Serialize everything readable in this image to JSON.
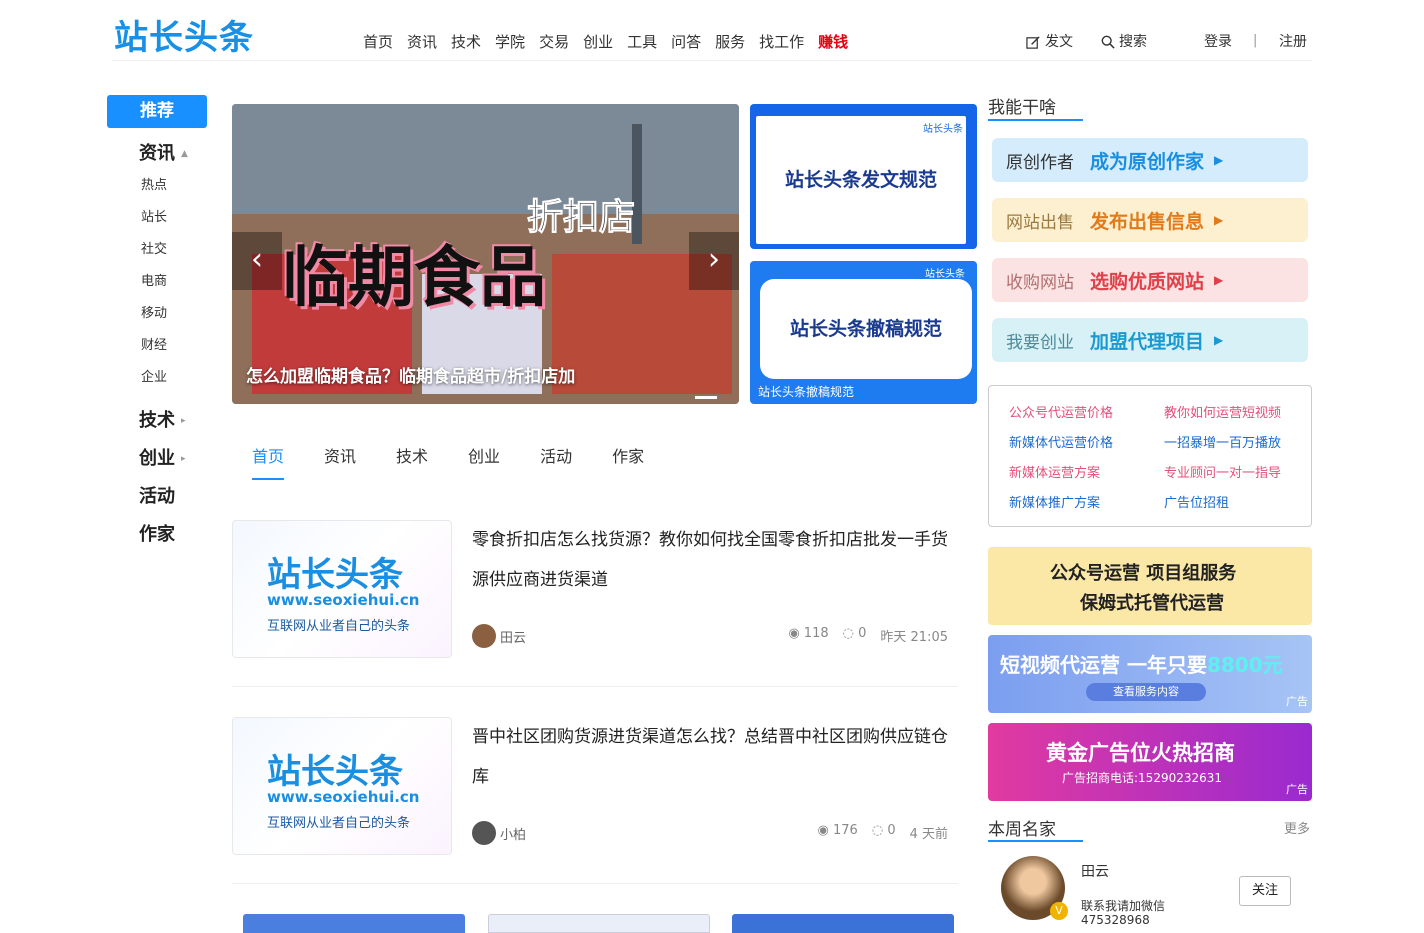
{
  "header": {
    "logo": "站长头条",
    "nav": [
      "首页",
      "资讯",
      "技术",
      "学院",
      "交易",
      "创业",
      "工具",
      "问答",
      "服务",
      "找工作",
      "赚钱"
    ],
    "post": "发文",
    "search": "搜索",
    "login": "登录",
    "sep": "|",
    "register": "注册"
  },
  "left_nav": {
    "recommend": "推荐",
    "cat_news": "资讯",
    "subs": [
      "热点",
      "站长",
      "社交",
      "电商",
      "移动",
      "财经",
      "企业"
    ],
    "cat_tech": "技术",
    "cat_startup": "创业",
    "cat_activity": "活动",
    "cat_author": "作家"
  },
  "slider": {
    "overlay_small": "折扣店",
    "overlay_big": "临期食品",
    "caption": "怎么加盟临期食品？临期食品超市/折扣店加",
    "prev": "‹",
    "next": "›"
  },
  "promos": [
    {
      "title": "站长头条发文规范",
      "tag": "站长头条"
    },
    {
      "title": "站长头条撤稿规范",
      "tag": "站长头条",
      "caption": "站长头条撤稿规范"
    }
  ],
  "tabs": [
    "首页",
    "资讯",
    "技术",
    "创业",
    "活动",
    "作家"
  ],
  "thumb": {
    "logo": "站长头条",
    "url": "www.seoxiehui.cn",
    "slogan": "互联网从业者自己的头条"
  },
  "articles": [
    {
      "title": "零食折扣店怎么找货源？教你如何找全国零食折扣店批发一手货源供应商进货渠道",
      "author": "田云",
      "views": "118",
      "comments": "0",
      "time": "昨天 21:05"
    },
    {
      "title": "晋中社区团购货源进货渠道怎么找？总结晋中社区团购供应链仓库",
      "author": "小柏",
      "views": "176",
      "comments": "0",
      "time": "4 天前"
    }
  ],
  "right": {
    "can_do_title": "我能干啥",
    "services": [
      {
        "a": "原创作者",
        "b": "成为原创作家"
      },
      {
        "a": "网站出售",
        "b": "发布出售信息"
      },
      {
        "a": "收购网站",
        "b": "选购优质网站"
      },
      {
        "a": "我要创业",
        "b": "加盟代理项目"
      }
    ],
    "links": [
      "公众号代运营价格",
      "教你如何运营短视频",
      "新媒体代运营价格",
      "一招暴增一百万播放",
      "新媒体运营方案",
      "专业顾问一对一指导",
      "新媒体推广方案",
      "广告位招租"
    ],
    "ads": [
      {
        "l1": "公众号运营 项目组服务",
        "l2": "保姆式托管代运营"
      },
      {
        "l1": "短视频代运营",
        "l2": "一年只要",
        "l3": "8800元",
        "btn": "查看服务内容",
        "tag": "广告"
      },
      {
        "l1": "黄金广告位火热招商",
        "l2": "广告招商电话:15290232631",
        "tag": "广告"
      }
    ],
    "weekly_title": "本周名家",
    "more": "更多",
    "famous": {
      "name": "田云",
      "desc": "联系我请加微信",
      "wx": "475328968",
      "follow": "关注"
    }
  },
  "colors": {
    "brand": "#1890ff",
    "hot": "#e60012"
  }
}
